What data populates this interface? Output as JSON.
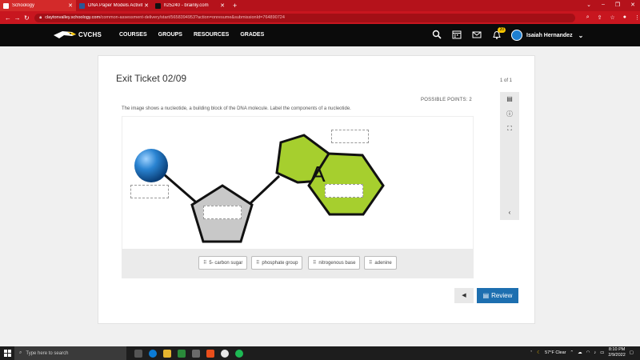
{
  "browser": {
    "tabs": [
      {
        "title": "Schoology",
        "active": true,
        "favicon_color": "#ffffff"
      },
      {
        "title": "DNA Paper Models Activity.docx",
        "active": false,
        "favicon_color": "#2b5797"
      },
      {
        "title": "h25240 - brainly.com",
        "active": false,
        "favicon_color": "#111111"
      }
    ],
    "new_tab": "+",
    "url_host": "claytonvalley.schoology.com",
    "url_path": "/common-assessment-delivery/start/5658394953?action=onresume&submissionId=764890724"
  },
  "header": {
    "logo_text": "CVCHS",
    "nav": [
      "COURSES",
      "GROUPS",
      "RESOURCES",
      "GRADES"
    ],
    "notification_count": "20",
    "user_name": "Isaiah Hernandez"
  },
  "assessment": {
    "title": "Exit Ticket 02/09",
    "page_count": "1 of 1",
    "points": "POSSIBLE POINTS: 2",
    "prompt": "The image shows a nucleotide, a building block of the DNA molecule. Label the components of a nucleotide.",
    "base_letter": "A",
    "answer_choices": [
      "5- carbon sugar",
      "phosphate group",
      "nitrogenous base",
      "adenine"
    ],
    "review_label": "Review"
  },
  "taskbar": {
    "search_placeholder": "Type here to search",
    "weather": "57°F  Clear",
    "time": "8:10 PM",
    "date": "2/9/2022"
  },
  "colors": {
    "browser_red": "#c8161f",
    "header_black": "#0b0b0b",
    "base_green": "#a6cf2e",
    "sugar_gray": "#c8c8c8",
    "phosphate_blue": "#1a6fb8",
    "review_blue": "#1d6fb0"
  }
}
